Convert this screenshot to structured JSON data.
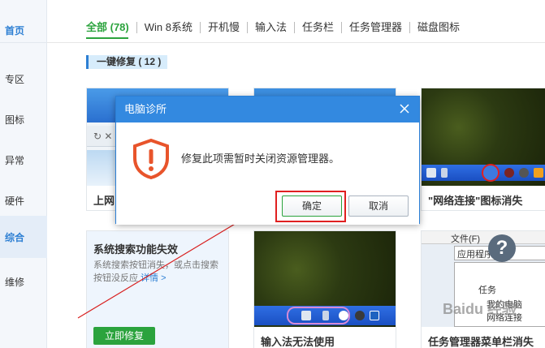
{
  "sidebar": {
    "items": [
      {
        "label": "首页"
      },
      {
        "label": "专区"
      },
      {
        "label": "图标"
      },
      {
        "label": "异常"
      },
      {
        "label": "硬件"
      },
      {
        "label": "综合"
      },
      {
        "label": "维修"
      }
    ]
  },
  "tabs": [
    {
      "label": "全部 (78)"
    },
    {
      "label": "Win 8系统"
    },
    {
      "label": "开机慢"
    },
    {
      "label": "输入法"
    },
    {
      "label": "任务栏"
    },
    {
      "label": "任务管理器"
    },
    {
      "label": "磁盘图标"
    }
  ],
  "section": {
    "title": "一键修复 ( 12 )"
  },
  "cards": {
    "card1": {
      "title": "上网"
    },
    "card3": {
      "title": "\"网络连接\"图标消失"
    },
    "search": {
      "title": "系统搜索功能失效",
      "desc": "系统搜索按钮消失，或点击搜索按钮没反应",
      "more": "详情 >",
      "fix_label": "立即修复"
    },
    "ime": {
      "title": "输入法无法使用"
    },
    "taskmgr": {
      "title": "任务管理器菜单栏消失",
      "menu_file": "文件(F)",
      "menu_app": "应用程序",
      "list_header": "任务",
      "item1": "我的电脑",
      "item2": "网络连接"
    }
  },
  "dialog": {
    "title": "电脑诊所",
    "message": "修复此项需暂时关闭资源管理器。",
    "ok_label": "确定",
    "cancel_label": "取消"
  },
  "watermark": "Baidu 经验",
  "colors": {
    "accent_green": "#2ba33d",
    "accent_blue": "#2d7fd3",
    "dialog_title": "#3389e0",
    "warning": "#e8542b",
    "highlight": "#e02020"
  }
}
